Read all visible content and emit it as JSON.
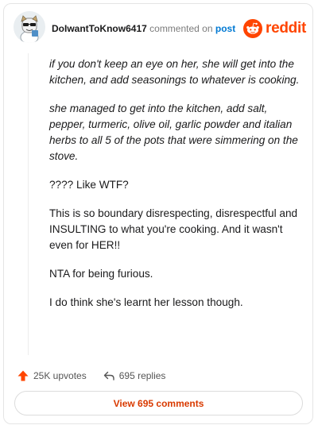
{
  "header": {
    "username": "DoIwantToKnow6417",
    "action_text": "commented on",
    "post_link": "post",
    "brand": "reddit"
  },
  "comment": {
    "paragraphs": [
      {
        "text": "if you don't keep an eye on her, she will get into the kitchen, and add seasonings to whatever is cooking.",
        "style": "italic"
      },
      {
        "text": "she managed to get into the kitchen, add salt, pepper, turmeric, olive oil, garlic powder and italian herbs to all 5 of the pots that were simmering on the stove.",
        "style": "italic"
      },
      {
        "text": "???? Like WTF?",
        "style": "normal"
      },
      {
        "text": "This is so boundary disrespecting, disrespectful and INSULTING to what you're cooking. And it wasn't even for HER!!",
        "style": "normal"
      },
      {
        "text": "NTA for being furious.",
        "style": "normal"
      },
      {
        "text": "I do think she's learnt her lesson though.",
        "style": "normal"
      }
    ]
  },
  "actions": {
    "upvotes": "25K upvotes",
    "replies": "695 replies"
  },
  "footer": {
    "view_button": "View 695 comments"
  },
  "colors": {
    "brand": "#ff4500",
    "link": "#0079d3",
    "button_text": "#d93a00"
  }
}
